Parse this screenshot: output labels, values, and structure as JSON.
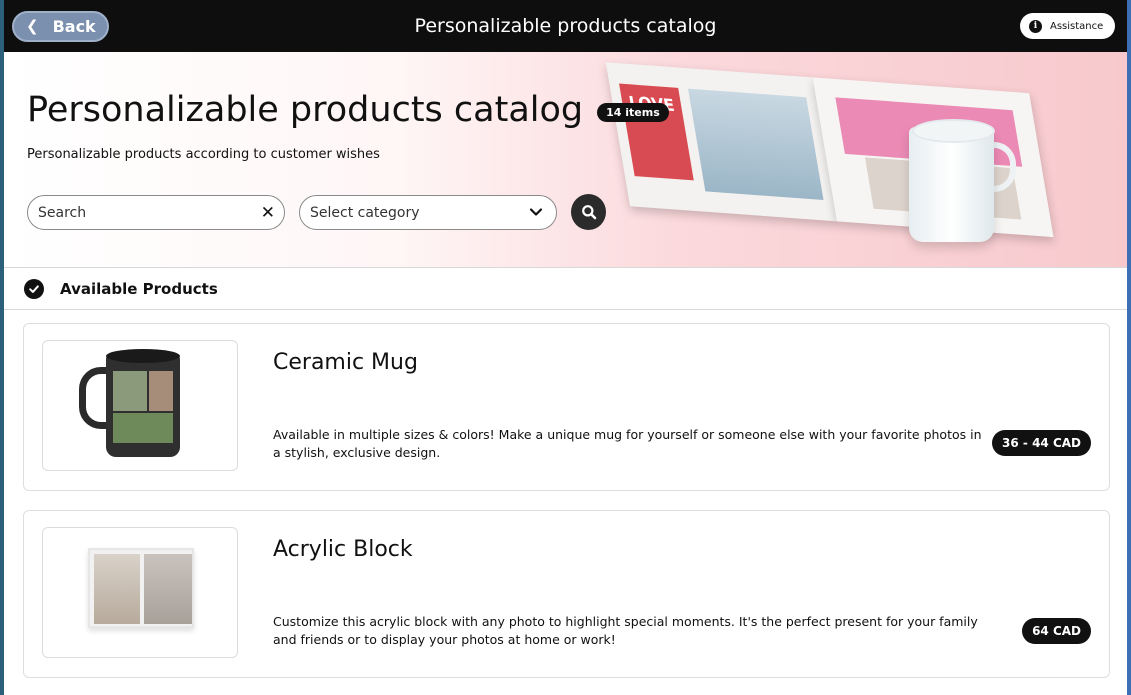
{
  "topbar": {
    "back_label": "Back",
    "title": "Personalizable products catalog",
    "assistance_label": "Assistance"
  },
  "hero": {
    "title": "Personalizable products catalog",
    "count_badge": "14 items",
    "subtitle": "Personalizable products according to customer wishes",
    "love_text": "LOVE"
  },
  "search": {
    "placeholder": "Search",
    "value": ""
  },
  "category": {
    "selected": "Select category"
  },
  "section": {
    "title": "Available Products"
  },
  "products": [
    {
      "title": "Ceramic Mug",
      "description": "Available in multiple sizes & colors! Make a unique mug for yourself or someone else with your favorite photos in a stylish, exclusive design.",
      "price": "36 - 44 CAD"
    },
    {
      "title": "Acrylic Block",
      "description": "Customize this acrylic block with any photo to highlight special moments. It's the perfect present for your family and friends or to display your photos at home or work!",
      "price": "64 CAD"
    }
  ],
  "colors": {
    "topbar_bg": "#0e0e0e",
    "back_button_bg": "#7b8fae",
    "hero_pink": "#f7c9cd",
    "badge_bg": "#111111"
  }
}
